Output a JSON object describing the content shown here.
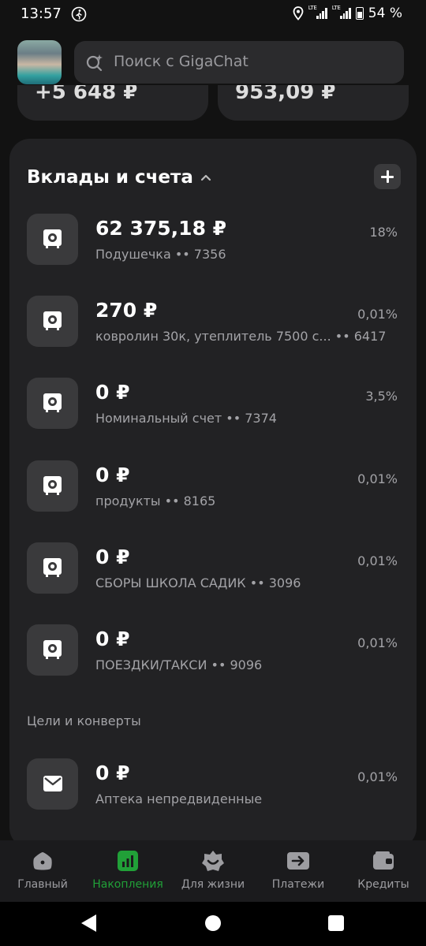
{
  "status_bar": {
    "time": "13:57",
    "battery": "54 %",
    "network": "LTE"
  },
  "search": {
    "placeholder": "Поиск с GigaChat"
  },
  "top_cards": [
    {
      "amount": "+5 648 ₽"
    },
    {
      "amount": "953,09 ₽"
    }
  ],
  "deposits": {
    "title": "Вклады и счета",
    "accounts": [
      {
        "amount": "62 375,18 ₽",
        "name": "Подушечка •• 7356",
        "rate": "18%"
      },
      {
        "amount": "270 ₽",
        "name": "ковролин 30к, утеплитель 7500 с... •• 6417",
        "rate": "0,01%"
      },
      {
        "amount": "0 ₽",
        "name": "Номинальный счет •• 7374",
        "rate": "3,5%"
      },
      {
        "amount": "0 ₽",
        "name": "продукты •• 8165",
        "rate": "0,01%"
      },
      {
        "amount": "0 ₽",
        "name": "СБОРЫ ШКОЛА САДИК •• 3096",
        "rate": "0,01%"
      },
      {
        "amount": "0 ₽",
        "name": "ПОЕЗДКИ/ТАКСИ •• 9096",
        "rate": "0,01%"
      }
    ]
  },
  "goals": {
    "title": "Цели и конверты",
    "items": [
      {
        "amount": "0 ₽",
        "name": "Аптека непредвиденные",
        "rate": "0,01%"
      }
    ]
  },
  "bottom_nav": [
    {
      "label": "Главный",
      "icon": "home-icon",
      "active": false
    },
    {
      "label": "Накопления",
      "icon": "chart-icon",
      "active": true
    },
    {
      "label": "Для жизни",
      "icon": "smile-icon",
      "active": false
    },
    {
      "label": "Платежи",
      "icon": "arrow-right-icon",
      "active": false
    },
    {
      "label": "Кредиты",
      "icon": "wallet-icon",
      "active": false
    }
  ],
  "colors": {
    "accent": "#21a038",
    "background": "#121212",
    "card": "#222224"
  }
}
